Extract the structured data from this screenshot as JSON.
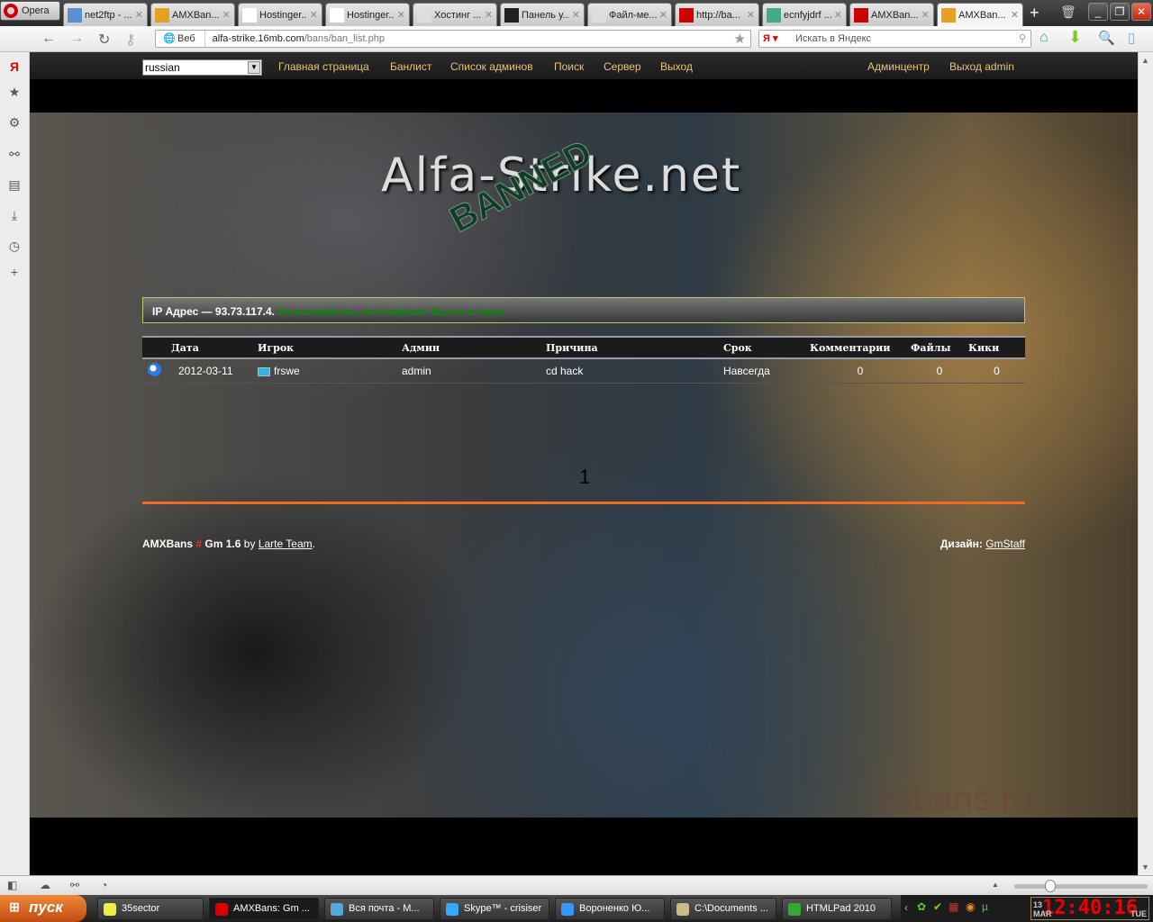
{
  "browser": {
    "menu_label": "Opera",
    "tabs": [
      {
        "label": "net2ftp - ..."
      },
      {
        "label": "AMXBan..."
      },
      {
        "label": "Hostinger..."
      },
      {
        "label": "Hostinger..."
      },
      {
        "label": "Хостинг ..."
      },
      {
        "label": "Панель у..."
      },
      {
        "label": "Файл-ме..."
      },
      {
        "label": "http://ba..."
      },
      {
        "label": "ecnfyjdrf ..."
      },
      {
        "label": "AMXBan..."
      },
      {
        "label": "AMXBan..."
      }
    ],
    "address_scope": "Веб",
    "url_host": "alfa-strike.16mb.com",
    "url_path": "/bans/ban_list.php",
    "search_placeholder": "Искать в Яндекс"
  },
  "site": {
    "language": "russian",
    "nav": [
      "Главная страница",
      "Банлист",
      "Список админов",
      "Поиск",
      "Сервер",
      "Выход"
    ],
    "nav_right": [
      "Админцентр",
      "Выход admin"
    ],
    "logo_text": "Alfa-Strike.net",
    "stamp_text": "BANNED",
    "ip_label": "IP Адрес — 93.73.117.4.",
    "ip_status": "Не волнуйтесь, все хорошо. Вы не в бане.",
    "table": {
      "headers": [
        "",
        "Дата",
        "Игрок",
        "Админ",
        "Причина",
        "Срок",
        "Комментарии",
        "Файлы",
        "Кики"
      ],
      "rows": [
        {
          "date": "2012-03-11",
          "player": "frswe",
          "admin": "admin",
          "reason": "cd hack",
          "term": "Навсегда",
          "comments": "0",
          "files": "0",
          "kicks": "0"
        }
      ]
    },
    "page_number": "1",
    "footer_brand": "AMXBans",
    "footer_hash": "#",
    "footer_version": "Gm 1.6",
    "footer_by": "by",
    "footer_team": "Larte Team",
    "footer_design_label": "Дизайн:",
    "footer_design_link": "GmStaff",
    "watermark": "csbans.ru"
  },
  "taskbar": {
    "start": "пуск",
    "items": [
      "35sector",
      "AMXBans: Gm ...",
      "Вся почта - M...",
      "Skype™ - crisiser",
      "Вороненко Ю...",
      "C:\\Documents ...",
      "HTMLPad 2010"
    ],
    "clock": "12:40:16",
    "day": "13",
    "month": "MAR",
    "weekday": "TUE"
  }
}
